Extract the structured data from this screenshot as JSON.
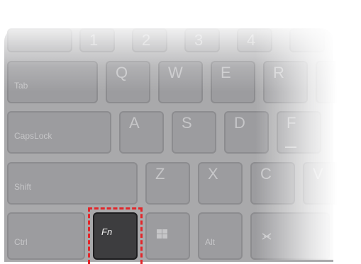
{
  "keyboard": {
    "row_numbers": [
      "",
      "1",
      "2",
      "3",
      "4"
    ],
    "row_qwerty": {
      "tab": "Tab",
      "keys": [
        "Q",
        "W",
        "E",
        "R"
      ]
    },
    "row_asdf": {
      "capslock": "CapsLock",
      "keys": [
        "A",
        "S",
        "D",
        "F"
      ]
    },
    "row_zxcv": {
      "shift": "Shift",
      "keys": [
        "Z",
        "X",
        "C",
        "V"
      ]
    },
    "row_bottom": {
      "ctrl": "Ctrl",
      "fn": "Fn",
      "alt": "Alt"
    }
  },
  "colors": {
    "highlight": "#e2262a",
    "key": "#9c9c9f",
    "fn_key": "#3d3d3f"
  },
  "icons": [
    "windows-icon",
    "mute-icon"
  ]
}
